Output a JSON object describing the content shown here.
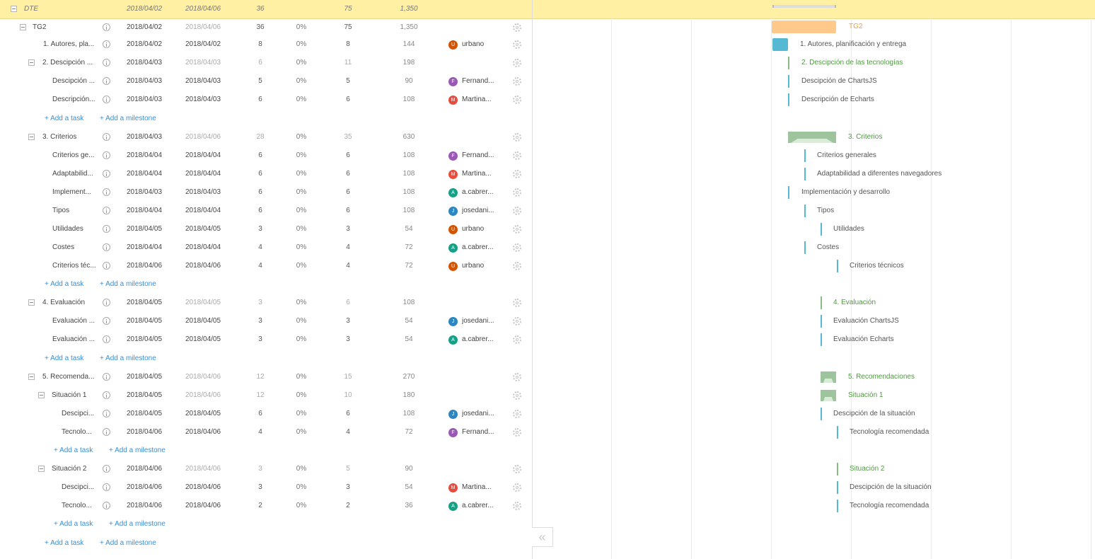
{
  "project": {
    "name": "DTE",
    "start": "2018/04/02",
    "end": "2018/04/06",
    "duration": "36",
    "work": "75",
    "cost": "1,350"
  },
  "tg2": {
    "name": "TG2",
    "start": "2018/04/02",
    "end": "2018/04/06",
    "duration": "36",
    "pct": "0%",
    "work": "75",
    "cost": "1,350"
  },
  "rows": [
    {
      "name": "1. Autores, pla...",
      "start": "2018/04/02",
      "end": "2018/04/02",
      "duration": "8",
      "pct": "0%",
      "work": "8",
      "cost": "144",
      "assignee": "urbano",
      "initial": "U",
      "avatar_color": "#d35400"
    },
    {
      "name": "2. Descipción ...",
      "start": "2018/04/03",
      "end": "2018/04/03",
      "duration": "6",
      "pct": "0%",
      "work": "11",
      "cost": "198"
    },
    {
      "name": "Descipción ...",
      "start": "2018/04/03",
      "end": "2018/04/03",
      "duration": "5",
      "pct": "0%",
      "work": "5",
      "cost": "90",
      "assignee": "Fernand...",
      "initial": "F",
      "avatar_color": "#9b59b6"
    },
    {
      "name": "Descripción...",
      "start": "2018/04/03",
      "end": "2018/04/03",
      "duration": "6",
      "pct": "0%",
      "work": "6",
      "cost": "108",
      "assignee": "Martina...",
      "initial": "M",
      "avatar_color": "#e74c3c"
    },
    {
      "name": "3. Criterios",
      "start": "2018/04/03",
      "end": "2018/04/06",
      "duration": "28",
      "pct": "0%",
      "work": "35",
      "cost": "630"
    },
    {
      "name": "Criterios ge...",
      "start": "2018/04/04",
      "end": "2018/04/04",
      "duration": "6",
      "pct": "0%",
      "work": "6",
      "cost": "108",
      "assignee": "Fernand...",
      "initial": "F",
      "avatar_color": "#9b59b6"
    },
    {
      "name": "Adaptabilid...",
      "start": "2018/04/04",
      "end": "2018/04/04",
      "duration": "6",
      "pct": "0%",
      "work": "6",
      "cost": "108",
      "assignee": "Martina...",
      "initial": "M",
      "avatar_color": "#e74c3c"
    },
    {
      "name": "Implement...",
      "start": "2018/04/03",
      "end": "2018/04/03",
      "duration": "6",
      "pct": "0%",
      "work": "6",
      "cost": "108",
      "assignee": "a.cabrer...",
      "initial": "A",
      "avatar_color": "#16a085"
    },
    {
      "name": "Tipos",
      "start": "2018/04/04",
      "end": "2018/04/04",
      "duration": "6",
      "pct": "0%",
      "work": "6",
      "cost": "108",
      "assignee": "josedani...",
      "initial": "J",
      "avatar_color": "#2e86c1"
    },
    {
      "name": "Utilidades",
      "start": "2018/04/05",
      "end": "2018/04/05",
      "duration": "3",
      "pct": "0%",
      "work": "3",
      "cost": "54",
      "assignee": "urbano",
      "initial": "U",
      "avatar_color": "#d35400"
    },
    {
      "name": "Costes",
      "start": "2018/04/04",
      "end": "2018/04/04",
      "duration": "4",
      "pct": "0%",
      "work": "4",
      "cost": "72",
      "assignee": "a.cabrer...",
      "initial": "A",
      "avatar_color": "#16a085"
    },
    {
      "name": "Criterios téc...",
      "start": "2018/04/06",
      "end": "2018/04/06",
      "duration": "4",
      "pct": "0%",
      "work": "4",
      "cost": "72",
      "assignee": "urbano",
      "initial": "U",
      "avatar_color": "#d35400"
    },
    {
      "name": "4. Evaluación",
      "start": "2018/04/05",
      "end": "2018/04/05",
      "duration": "3",
      "pct": "0%",
      "work": "6",
      "cost": "108"
    },
    {
      "name": "Evaluación ...",
      "start": "2018/04/05",
      "end": "2018/04/05",
      "duration": "3",
      "pct": "0%",
      "work": "3",
      "cost": "54",
      "assignee": "josedani...",
      "initial": "J",
      "avatar_color": "#2e86c1"
    },
    {
      "name": "Evaluación ...",
      "start": "2018/04/05",
      "end": "2018/04/05",
      "duration": "3",
      "pct": "0%",
      "work": "3",
      "cost": "54",
      "assignee": "a.cabrer...",
      "initial": "A",
      "avatar_color": "#16a085"
    },
    {
      "name": "5. Recomenda...",
      "start": "2018/04/05",
      "end": "2018/04/06",
      "duration": "12",
      "pct": "0%",
      "work": "15",
      "cost": "270"
    },
    {
      "name": "Situación 1",
      "start": "2018/04/05",
      "end": "2018/04/06",
      "duration": "12",
      "pct": "0%",
      "work": "10",
      "cost": "180"
    },
    {
      "name": "Descipci...",
      "start": "2018/04/05",
      "end": "2018/04/05",
      "duration": "6",
      "pct": "0%",
      "work": "6",
      "cost": "108",
      "assignee": "josedani...",
      "initial": "J",
      "avatar_color": "#2e86c1"
    },
    {
      "name": "Tecnolo...",
      "start": "2018/04/06",
      "end": "2018/04/06",
      "duration": "4",
      "pct": "0%",
      "work": "4",
      "cost": "72",
      "assignee": "Fernand...",
      "initial": "F",
      "avatar_color": "#9b59b6"
    },
    {
      "name": "Situación 2",
      "start": "2018/04/06",
      "end": "2018/04/06",
      "duration": "3",
      "pct": "0%",
      "work": "5",
      "cost": "90"
    },
    {
      "name": "Descipci...",
      "start": "2018/04/06",
      "end": "2018/04/06",
      "duration": "3",
      "pct": "0%",
      "work": "3",
      "cost": "54",
      "assignee": "Martina...",
      "initial": "M",
      "avatar_color": "#e74c3c"
    },
    {
      "name": "Tecnolo...",
      "start": "2018/04/06",
      "end": "2018/04/06",
      "duration": "2",
      "pct": "0%",
      "work": "2",
      "cost": "36",
      "assignee": "a.cabrer...",
      "initial": "A",
      "avatar_color": "#16a085"
    }
  ],
  "add": {
    "task": "+ Add a task",
    "milestone": "+ Add a milestone"
  },
  "gantt": {
    "tg2": "TG2",
    "labels": [
      "1. Autores, planificación y entrega",
      "2. Descipción de las tecnologías",
      "Descipción de ChartsJS",
      "Descripción de Echarts",
      "3. Criterios",
      "Criterios generales",
      "Adaptabilidad a diferentes navegadores",
      "Implementación y desarrollo",
      "Tipos",
      "Utilidades",
      "Costes",
      "Criterios técnicos",
      "4. Evaluación",
      "Evaluación ChartsJS",
      "Evaluación Echarts",
      "5. Recomendaciones",
      "Situación 1",
      "Descipción de la situación",
      "Tecnología recomendada",
      "Situación 2",
      "Descipción de la situación",
      "Tecnología recomendada"
    ]
  },
  "colors": {
    "banner": "#fff0a3",
    "summary_text": "#4e9a3f",
    "tg2_text": "#f0a040",
    "task_bar": "#56b9d3",
    "summary_bar": "#89ba87",
    "link": "#3a8fd6"
  },
  "icons": [
    "collapse-toggle-icon",
    "info-icon",
    "gear-icon",
    "collapse-panel-icon"
  ]
}
